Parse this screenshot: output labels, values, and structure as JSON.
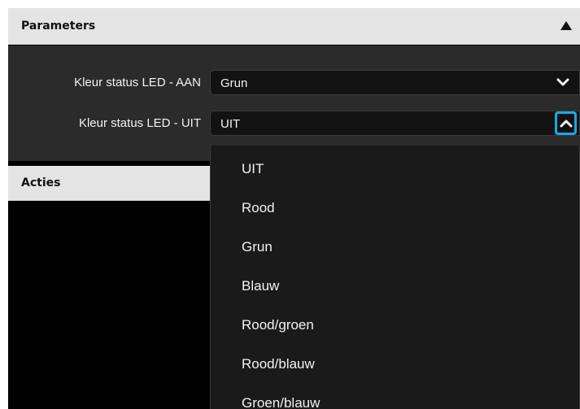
{
  "parameters": {
    "title": "Parameters"
  },
  "fields": [
    {
      "label": "Kleur status LED - AAN",
      "value": "Grun",
      "state": "closed"
    },
    {
      "label": "Kleur status LED - UIT",
      "value": "UIT",
      "state": "open"
    }
  ],
  "actions": {
    "title": "Acties"
  },
  "dropdown": {
    "options": [
      "UIT",
      "Rood",
      "Grun",
      "Blauw",
      "Rood/groen",
      "Rood/blauw",
      "Groen/blauw"
    ]
  },
  "icons": {
    "collapse": "triangle-up-icon",
    "dropdown_closed": "chevron-down-icon",
    "dropdown_open": "chevron-up-icon"
  },
  "colors": {
    "accent_focus": "#19a7e6",
    "header_bg": "#e4e4e4",
    "panel_bg": "#2b2b2b",
    "field_bg": "#121212",
    "list_bg": "#1a1a1a"
  }
}
